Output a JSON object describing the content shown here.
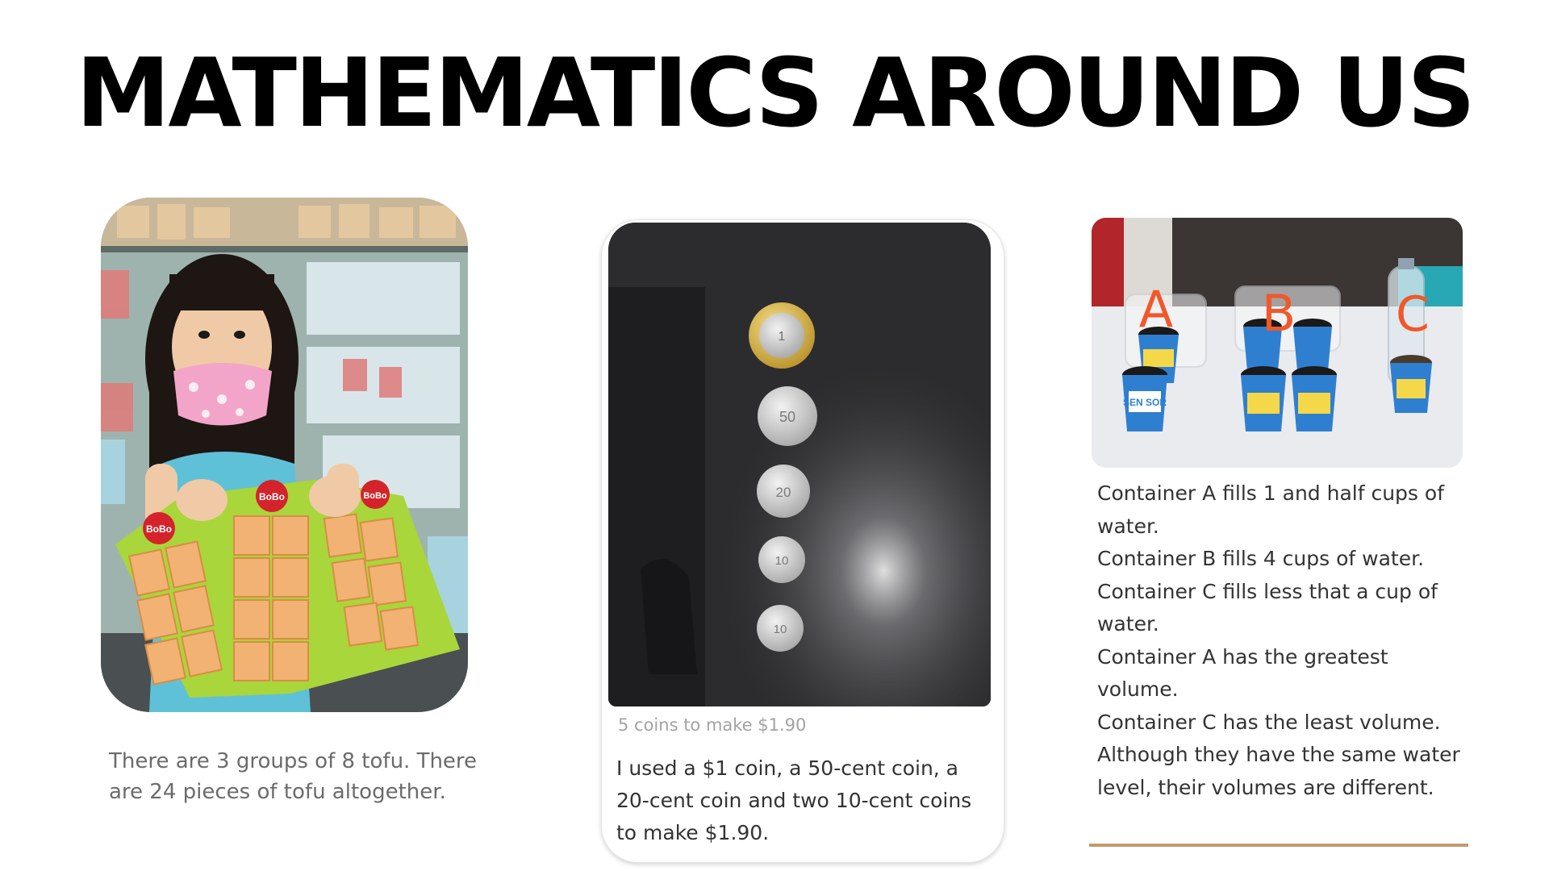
{
  "title": "MATHEMATICS AROUND US",
  "panels": {
    "tofu": {
      "caption": "There are 3 groups of 8 tofu. There are 24 pieces of tofu altogether.",
      "package_label": "BoBo"
    },
    "coins": {
      "subtitle": "5 coins to make $1.90",
      "caption": "I used a $1 coin, a 50-cent coin, a 20-cent coin and two 10-cent coins to make $1.90.",
      "coin_labels": [
        "1",
        "50",
        "20",
        "10",
        "10"
      ]
    },
    "containers": {
      "labels": [
        "A",
        "B",
        "C"
      ],
      "cup_text": "SEN SOR",
      "lines": [
        "Container A fills 1 and half cups of water.",
        "Container B fills 4 cups of water.",
        "Container C fills less that a cup of water.",
        "Container A has the greatest volume.",
        "Container C has the least volume.",
        "Although they have the same water level, their volumes are different."
      ]
    }
  },
  "colors": {
    "title": "#000000",
    "accent_rule": "#c49a6c",
    "label_orange": "#f0582a"
  }
}
